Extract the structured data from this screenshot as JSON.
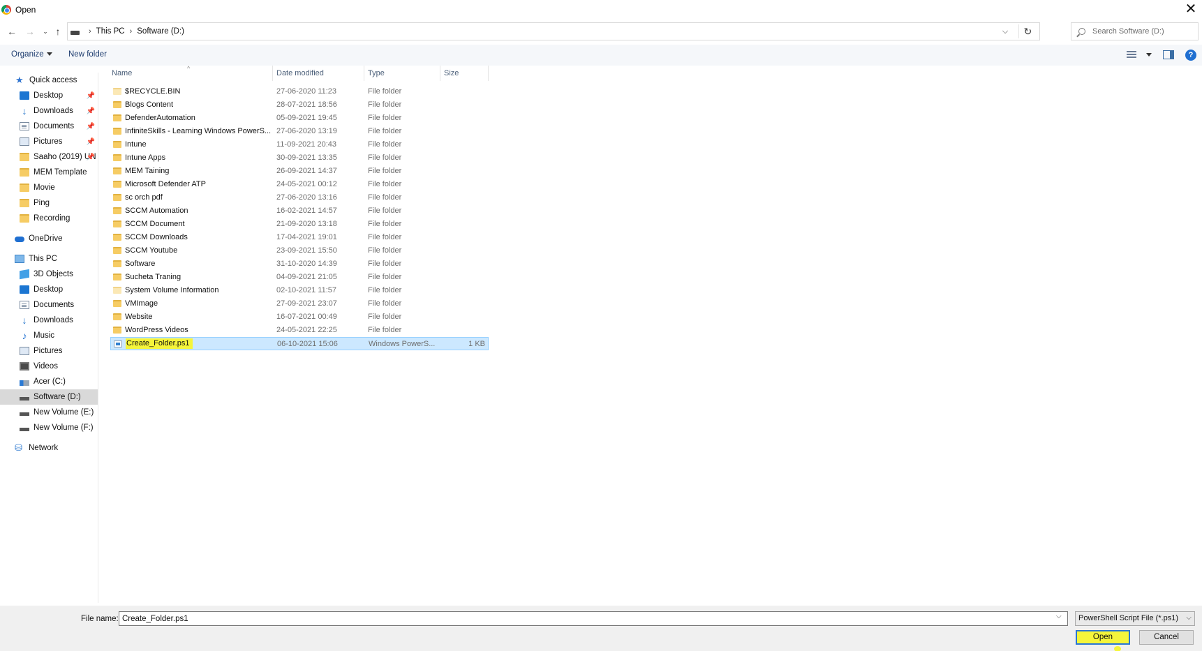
{
  "window": {
    "title": "Open"
  },
  "address": {
    "crumbs": [
      "This PC",
      "Software (D:)"
    ]
  },
  "search": {
    "placeholder": "Search Software (D:)"
  },
  "toolbar": {
    "organize": "Organize",
    "new_folder": "New folder"
  },
  "sidebar": {
    "items": [
      {
        "label": "Quick access",
        "icon": "quick-access-star-icon",
        "pinned": false
      },
      {
        "label": "Desktop",
        "icon": "desktop-icon",
        "pinned": true
      },
      {
        "label": "Downloads",
        "icon": "downloads-icon",
        "pinned": true
      },
      {
        "label": "Documents",
        "icon": "documents-icon",
        "pinned": true
      },
      {
        "label": "Pictures",
        "icon": "pictures-icon",
        "pinned": true
      },
      {
        "label": "Saaho (2019) UN",
        "icon": "folder-icon",
        "pinned": true
      },
      {
        "label": "MEM Template",
        "icon": "folder-icon",
        "pinned": false
      },
      {
        "label": "Movie",
        "icon": "folder-icon",
        "pinned": false
      },
      {
        "label": "Ping",
        "icon": "folder-icon",
        "pinned": false
      },
      {
        "label": "Recording",
        "icon": "folder-icon",
        "pinned": false
      },
      {
        "label": "OneDrive",
        "icon": "onedrive-cloud-icon",
        "pinned": false
      },
      {
        "label": "This PC",
        "icon": "this-pc-icon",
        "pinned": false
      },
      {
        "label": "3D Objects",
        "icon": "3d-objects-icon",
        "pinned": false
      },
      {
        "label": "Desktop",
        "icon": "desktop-icon",
        "pinned": false
      },
      {
        "label": "Documents",
        "icon": "documents-icon",
        "pinned": false
      },
      {
        "label": "Downloads",
        "icon": "downloads-icon",
        "pinned": false
      },
      {
        "label": "Music",
        "icon": "music-icon",
        "pinned": false
      },
      {
        "label": "Pictures",
        "icon": "pictures-icon",
        "pinned": false
      },
      {
        "label": "Videos",
        "icon": "videos-icon",
        "pinned": false
      },
      {
        "label": "Acer (C:)",
        "icon": "system-drive-icon",
        "pinned": false
      },
      {
        "label": "Software (D:)",
        "icon": "drive-icon",
        "pinned": false,
        "selected": true
      },
      {
        "label": "New Volume (E:)",
        "icon": "drive-icon",
        "pinned": false
      },
      {
        "label": "New Volume (F:)",
        "icon": "drive-icon",
        "pinned": false
      },
      {
        "label": "Network",
        "icon": "network-icon",
        "pinned": false
      }
    ]
  },
  "columns": {
    "name": "Name",
    "date": "Date modified",
    "type": "Type",
    "size": "Size"
  },
  "files": [
    {
      "name": "$RECYCLE.BIN",
      "date": "27-06-2020 11:23",
      "type": "File folder",
      "size": ""
    },
    {
      "name": "Blogs Content",
      "date": "28-07-2021 18:56",
      "type": "File folder",
      "size": ""
    },
    {
      "name": "DefenderAutomation",
      "date": "05-09-2021 19:45",
      "type": "File folder",
      "size": ""
    },
    {
      "name": "InfiniteSkills - Learning Windows PowerS...",
      "date": "27-06-2020 13:19",
      "type": "File folder",
      "size": ""
    },
    {
      "name": "Intune",
      "date": "11-09-2021 20:43",
      "type": "File folder",
      "size": ""
    },
    {
      "name": "Intune Apps",
      "date": "30-09-2021 13:35",
      "type": "File folder",
      "size": ""
    },
    {
      "name": "MEM Taining",
      "date": "26-09-2021 14:37",
      "type": "File folder",
      "size": ""
    },
    {
      "name": "Microsoft Defender ATP",
      "date": "24-05-2021 00:12",
      "type": "File folder",
      "size": ""
    },
    {
      "name": "sc orch pdf",
      "date": "27-06-2020 13:16",
      "type": "File folder",
      "size": ""
    },
    {
      "name": "SCCM Automation",
      "date": "16-02-2021 14:57",
      "type": "File folder",
      "size": ""
    },
    {
      "name": "SCCM Document",
      "date": "21-09-2020 13:18",
      "type": "File folder",
      "size": ""
    },
    {
      "name": "SCCM Downloads",
      "date": "17-04-2021 19:01",
      "type": "File folder",
      "size": ""
    },
    {
      "name": "SCCM Youtube",
      "date": "23-09-2021 15:50",
      "type": "File folder",
      "size": ""
    },
    {
      "name": "Software",
      "date": "31-10-2020 14:39",
      "type": "File folder",
      "size": ""
    },
    {
      "name": "Sucheta Traning",
      "date": "04-09-2021 21:05",
      "type": "File folder",
      "size": ""
    },
    {
      "name": "System Volume Information",
      "date": "02-10-2021 11:57",
      "type": "File folder",
      "size": ""
    },
    {
      "name": "VMImage",
      "date": "27-09-2021 23:07",
      "type": "File folder",
      "size": ""
    },
    {
      "name": "Website",
      "date": "16-07-2021 00:49",
      "type": "File folder",
      "size": ""
    },
    {
      "name": "WordPress Videos",
      "date": "24-05-2021 22:25",
      "type": "File folder",
      "size": ""
    },
    {
      "name": "Create_Folder.ps1",
      "date": "06-10-2021 15:06",
      "type": "Windows PowerS...",
      "size": "1 KB"
    }
  ],
  "bottom": {
    "file_name_label": "File name:",
    "file_name_value": "Create_Folder.ps1",
    "filter": "PowerShell Script File (*.ps1)",
    "open": "Open",
    "cancel": "Cancel"
  },
  "colors": {
    "accent": "#1f6fd1",
    "highlight": "#f5f53a",
    "selection": "#cce8ff",
    "selected_nav": "#d9d9d9"
  }
}
